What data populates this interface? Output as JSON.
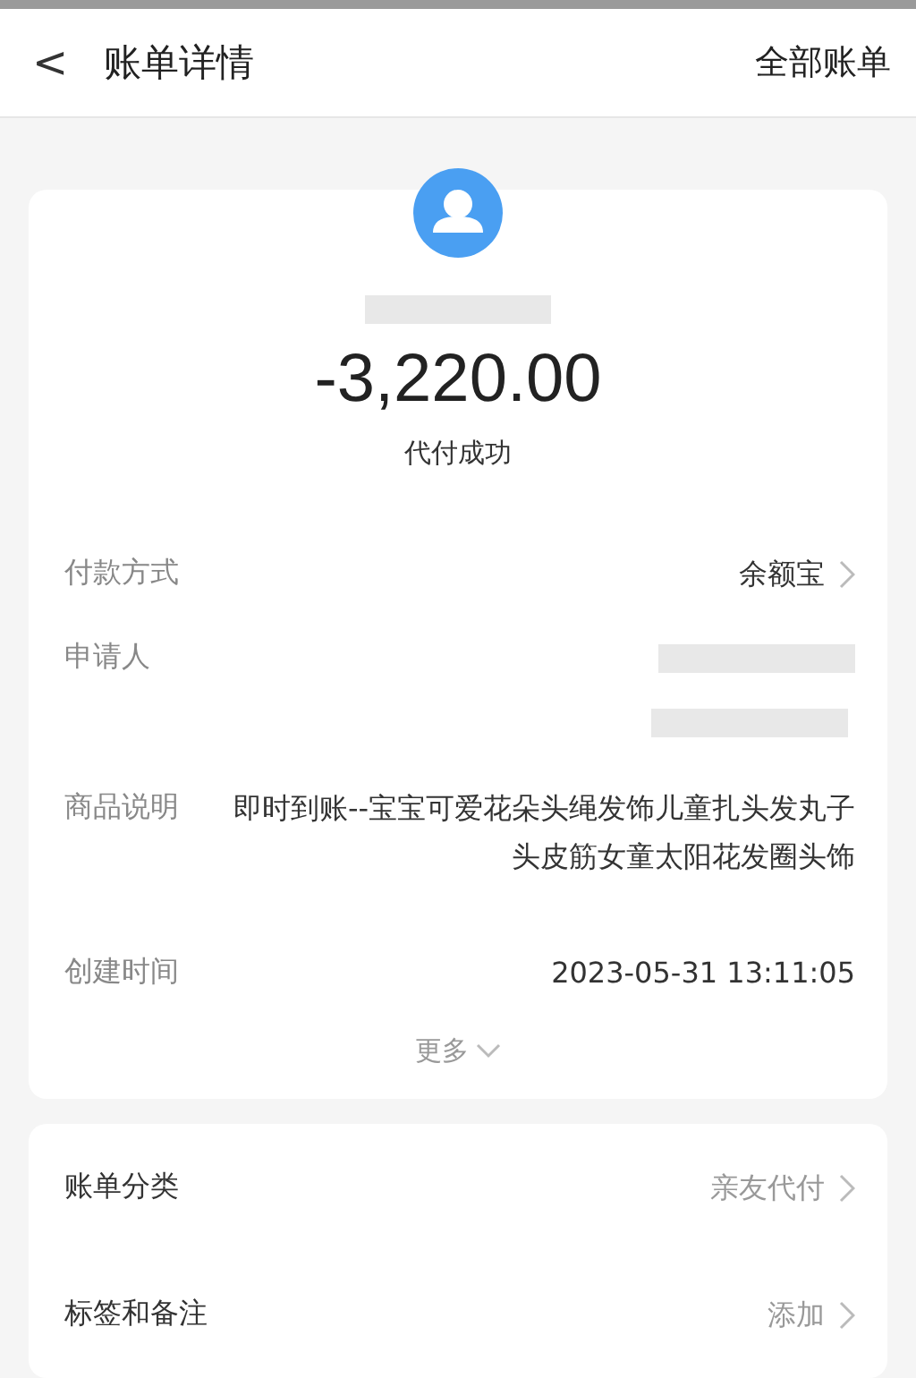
{
  "header": {
    "back": "<",
    "title": "账单详情",
    "action": "全部账单"
  },
  "summary": {
    "payee": {
      "kind": "redacted"
    },
    "amount": "-3,220.00",
    "status": "代付成功"
  },
  "details": [
    {
      "kind": "link",
      "label": "付款方式",
      "value": "余额宝"
    },
    {
      "kind": "redacted",
      "label": "申请人"
    },
    {
      "kind": "text",
      "label": "商品说明",
      "value": "即时到账--宝宝可爱花朵头绳发饰儿童扎头发丸子头皮筋女童太阳花发圈头饰"
    },
    {
      "kind": "text",
      "label": "创建时间",
      "value": "2023-05-31 13:11:05"
    }
  ],
  "more": {
    "label": "更多",
    "expanded": false
  },
  "settings": [
    {
      "label": "账单分类",
      "value": "亲友代付"
    },
    {
      "label": "标签和备注",
      "value": "添加"
    }
  ]
}
